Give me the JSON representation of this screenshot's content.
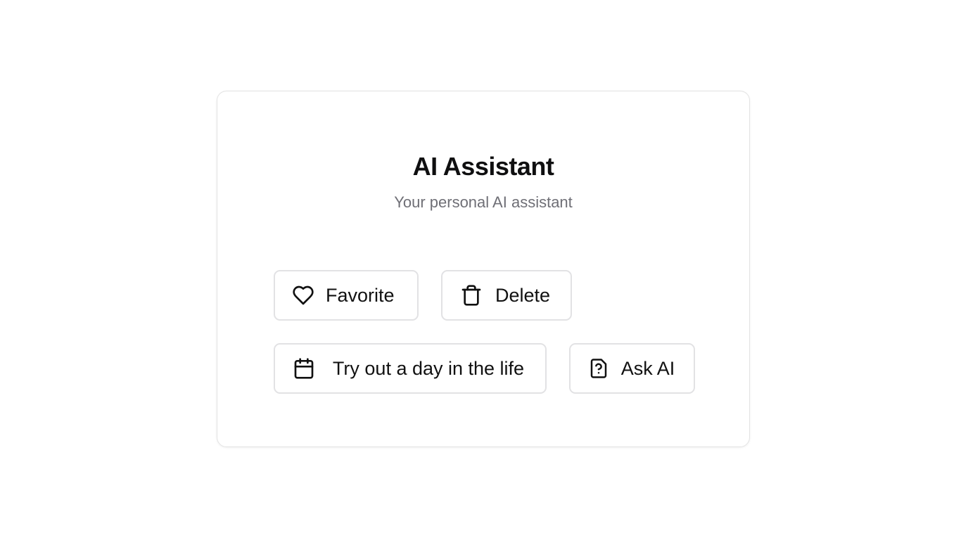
{
  "card": {
    "title": "AI Assistant",
    "subtitle": "Your personal AI assistant"
  },
  "actions": [
    {
      "label": "Favorite",
      "icon": "heart-icon"
    },
    {
      "label": "Delete",
      "icon": "trash-icon"
    },
    {
      "label": "Try out a day in the life",
      "icon": "calendar-icon"
    },
    {
      "label": "Ask AI",
      "icon": "file-question-icon"
    }
  ],
  "colors": {
    "text": "#111111",
    "muted": "#6f6f76",
    "border": "#e2e2e4",
    "background": "#ffffff"
  }
}
